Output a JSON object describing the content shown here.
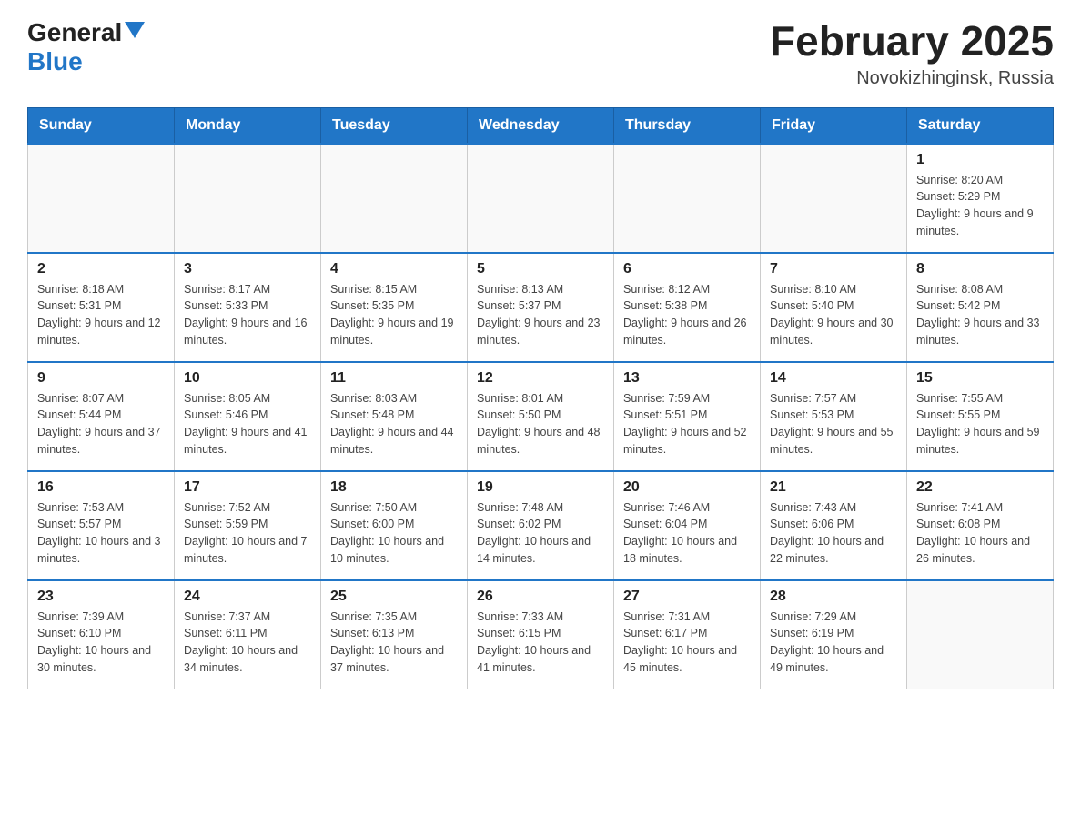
{
  "header": {
    "logo_general": "General",
    "logo_blue": "Blue",
    "title": "February 2025",
    "subtitle": "Novokizhinginsk, Russia"
  },
  "days_of_week": [
    "Sunday",
    "Monday",
    "Tuesday",
    "Wednesday",
    "Thursday",
    "Friday",
    "Saturday"
  ],
  "weeks": [
    [
      {
        "day": "",
        "info": ""
      },
      {
        "day": "",
        "info": ""
      },
      {
        "day": "",
        "info": ""
      },
      {
        "day": "",
        "info": ""
      },
      {
        "day": "",
        "info": ""
      },
      {
        "day": "",
        "info": ""
      },
      {
        "day": "1",
        "info": "Sunrise: 8:20 AM\nSunset: 5:29 PM\nDaylight: 9 hours and 9 minutes."
      }
    ],
    [
      {
        "day": "2",
        "info": "Sunrise: 8:18 AM\nSunset: 5:31 PM\nDaylight: 9 hours and 12 minutes."
      },
      {
        "day": "3",
        "info": "Sunrise: 8:17 AM\nSunset: 5:33 PM\nDaylight: 9 hours and 16 minutes."
      },
      {
        "day": "4",
        "info": "Sunrise: 8:15 AM\nSunset: 5:35 PM\nDaylight: 9 hours and 19 minutes."
      },
      {
        "day": "5",
        "info": "Sunrise: 8:13 AM\nSunset: 5:37 PM\nDaylight: 9 hours and 23 minutes."
      },
      {
        "day": "6",
        "info": "Sunrise: 8:12 AM\nSunset: 5:38 PM\nDaylight: 9 hours and 26 minutes."
      },
      {
        "day": "7",
        "info": "Sunrise: 8:10 AM\nSunset: 5:40 PM\nDaylight: 9 hours and 30 minutes."
      },
      {
        "day": "8",
        "info": "Sunrise: 8:08 AM\nSunset: 5:42 PM\nDaylight: 9 hours and 33 minutes."
      }
    ],
    [
      {
        "day": "9",
        "info": "Sunrise: 8:07 AM\nSunset: 5:44 PM\nDaylight: 9 hours and 37 minutes."
      },
      {
        "day": "10",
        "info": "Sunrise: 8:05 AM\nSunset: 5:46 PM\nDaylight: 9 hours and 41 minutes."
      },
      {
        "day": "11",
        "info": "Sunrise: 8:03 AM\nSunset: 5:48 PM\nDaylight: 9 hours and 44 minutes."
      },
      {
        "day": "12",
        "info": "Sunrise: 8:01 AM\nSunset: 5:50 PM\nDaylight: 9 hours and 48 minutes."
      },
      {
        "day": "13",
        "info": "Sunrise: 7:59 AM\nSunset: 5:51 PM\nDaylight: 9 hours and 52 minutes."
      },
      {
        "day": "14",
        "info": "Sunrise: 7:57 AM\nSunset: 5:53 PM\nDaylight: 9 hours and 55 minutes."
      },
      {
        "day": "15",
        "info": "Sunrise: 7:55 AM\nSunset: 5:55 PM\nDaylight: 9 hours and 59 minutes."
      }
    ],
    [
      {
        "day": "16",
        "info": "Sunrise: 7:53 AM\nSunset: 5:57 PM\nDaylight: 10 hours and 3 minutes."
      },
      {
        "day": "17",
        "info": "Sunrise: 7:52 AM\nSunset: 5:59 PM\nDaylight: 10 hours and 7 minutes."
      },
      {
        "day": "18",
        "info": "Sunrise: 7:50 AM\nSunset: 6:00 PM\nDaylight: 10 hours and 10 minutes."
      },
      {
        "day": "19",
        "info": "Sunrise: 7:48 AM\nSunset: 6:02 PM\nDaylight: 10 hours and 14 minutes."
      },
      {
        "day": "20",
        "info": "Sunrise: 7:46 AM\nSunset: 6:04 PM\nDaylight: 10 hours and 18 minutes."
      },
      {
        "day": "21",
        "info": "Sunrise: 7:43 AM\nSunset: 6:06 PM\nDaylight: 10 hours and 22 minutes."
      },
      {
        "day": "22",
        "info": "Sunrise: 7:41 AM\nSunset: 6:08 PM\nDaylight: 10 hours and 26 minutes."
      }
    ],
    [
      {
        "day": "23",
        "info": "Sunrise: 7:39 AM\nSunset: 6:10 PM\nDaylight: 10 hours and 30 minutes."
      },
      {
        "day": "24",
        "info": "Sunrise: 7:37 AM\nSunset: 6:11 PM\nDaylight: 10 hours and 34 minutes."
      },
      {
        "day": "25",
        "info": "Sunrise: 7:35 AM\nSunset: 6:13 PM\nDaylight: 10 hours and 37 minutes."
      },
      {
        "day": "26",
        "info": "Sunrise: 7:33 AM\nSunset: 6:15 PM\nDaylight: 10 hours and 41 minutes."
      },
      {
        "day": "27",
        "info": "Sunrise: 7:31 AM\nSunset: 6:17 PM\nDaylight: 10 hours and 45 minutes."
      },
      {
        "day": "28",
        "info": "Sunrise: 7:29 AM\nSunset: 6:19 PM\nDaylight: 10 hours and 49 minutes."
      },
      {
        "day": "",
        "info": ""
      }
    ]
  ]
}
